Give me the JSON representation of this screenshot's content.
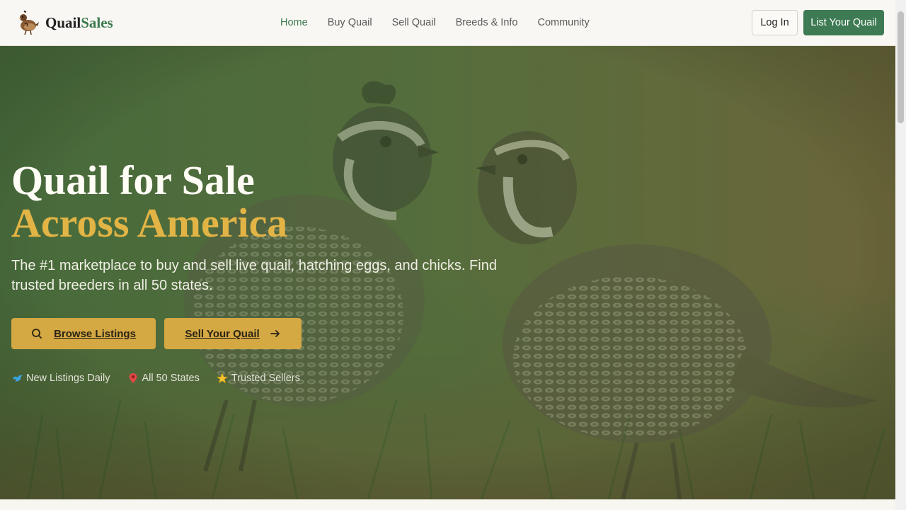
{
  "brand": {
    "name_part1": "Quail",
    "name_part2": "Sales",
    "logo_icon": "quail-logo-icon"
  },
  "nav": {
    "items": [
      {
        "label": "Home",
        "active": true
      },
      {
        "label": "Buy Quail",
        "active": false
      },
      {
        "label": "Sell Quail",
        "active": false
      },
      {
        "label": "Breeds & Info",
        "active": false
      },
      {
        "label": "Community",
        "active": false
      }
    ]
  },
  "header": {
    "login_label": "Log In",
    "list_label": "List Your Quail"
  },
  "hero": {
    "title_line1": "Quail for Sale",
    "title_line2": "Across America",
    "subtitle": "The #1 marketplace to buy and sell live quail, hatching eggs, and chicks. Find trusted breeders in all 50 states.",
    "browse_label": "Browse Listings",
    "sell_label": "Sell Your Quail",
    "features": [
      {
        "icon": "bird-icon",
        "label": "New Listings Daily"
      },
      {
        "icon": "pin-icon",
        "label": "All 50 States"
      },
      {
        "icon": "star-icon",
        "label": "Trusted Sellers"
      }
    ]
  },
  "colors": {
    "brand_green": "#3e7a53",
    "accent_gold": "#d4a843",
    "title_gold": "#e2b445"
  }
}
